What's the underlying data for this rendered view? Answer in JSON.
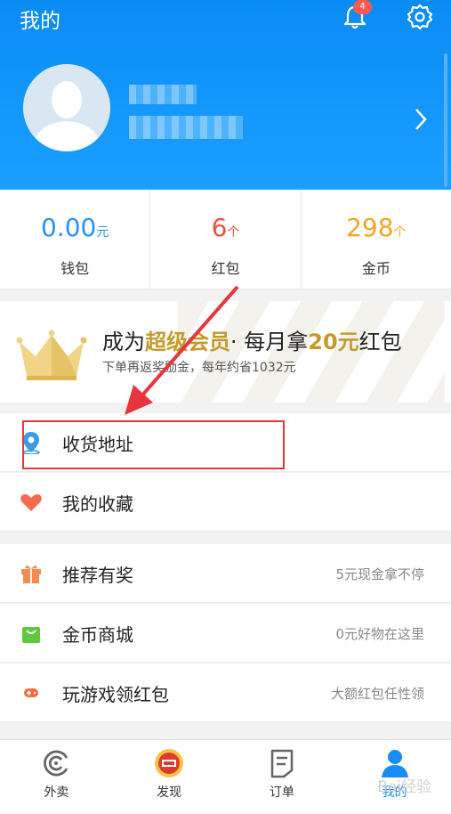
{
  "header": {
    "title": "我的",
    "notification_count": "4"
  },
  "stats": [
    {
      "value": "0.00",
      "unit": "元",
      "label": "钱包",
      "color": "#2a92f0"
    },
    {
      "value": "6",
      "unit": "个",
      "label": "红包",
      "color": "#f0503c"
    },
    {
      "value": "298",
      "unit": "个",
      "label": "金币",
      "color": "#f5a524"
    }
  ],
  "promo": {
    "title_pre": "成为",
    "title_gold1": "超级会员",
    "title_mid": "· 每月拿",
    "title_gold2": "20元",
    "title_post": "红包",
    "subtitle": "下单再返奖励金，每年约省1032元"
  },
  "menu_group1": [
    {
      "label": "收货地址",
      "icon": "location-pin-icon"
    },
    {
      "label": "我的收藏",
      "icon": "heart-icon"
    }
  ],
  "menu_group2": [
    {
      "label": "推荐有奖",
      "hint": "5元现金拿不停",
      "icon": "gift-icon"
    },
    {
      "label": "金币商城",
      "hint": "0元好物在这里",
      "icon": "shopping-bag-icon"
    },
    {
      "label": "玩游戏领红包",
      "hint": "大额红包任性领",
      "icon": "gamepad-icon"
    }
  ],
  "tabs": [
    {
      "label": "外卖",
      "icon": "takeout-icon"
    },
    {
      "label": "发现",
      "icon": "discover-icon"
    },
    {
      "label": "订单",
      "icon": "order-icon"
    },
    {
      "label": "我的",
      "icon": "profile-icon",
      "active": true
    }
  ],
  "watermark": "Bai经验"
}
